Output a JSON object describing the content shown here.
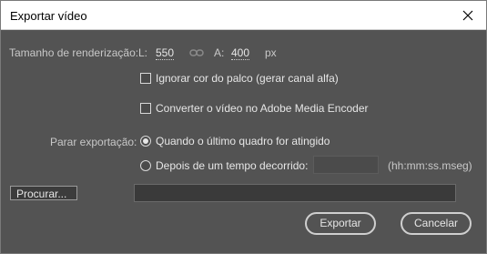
{
  "window": {
    "title": "Exportar vídeo"
  },
  "render_size": {
    "label": "Tamanho de renderização:",
    "width_label": "L:",
    "width_value": "550",
    "height_label": "A:",
    "height_value": "400",
    "unit": "px"
  },
  "options": {
    "ignore_stage_color": {
      "label": "Ignorar cor do palco (gerar canal alfa)",
      "checked": false
    },
    "convert_media_encoder": {
      "label": "Converter o vídeo no Adobe Media Encoder",
      "checked": false
    }
  },
  "stop_export": {
    "label": "Parar exportação:",
    "option_last_frame": {
      "label": "Quando o último quadro for atingido",
      "selected": true
    },
    "option_elapsed": {
      "label": "Depois de um tempo decorrido:",
      "selected": false
    },
    "time_value": "",
    "time_format": "(hh:mm:ss.mseg)"
  },
  "browse": {
    "button_label": "Procurar...",
    "path_value": ""
  },
  "footer": {
    "export_label": "Exportar",
    "cancel_label": "Cancelar"
  }
}
